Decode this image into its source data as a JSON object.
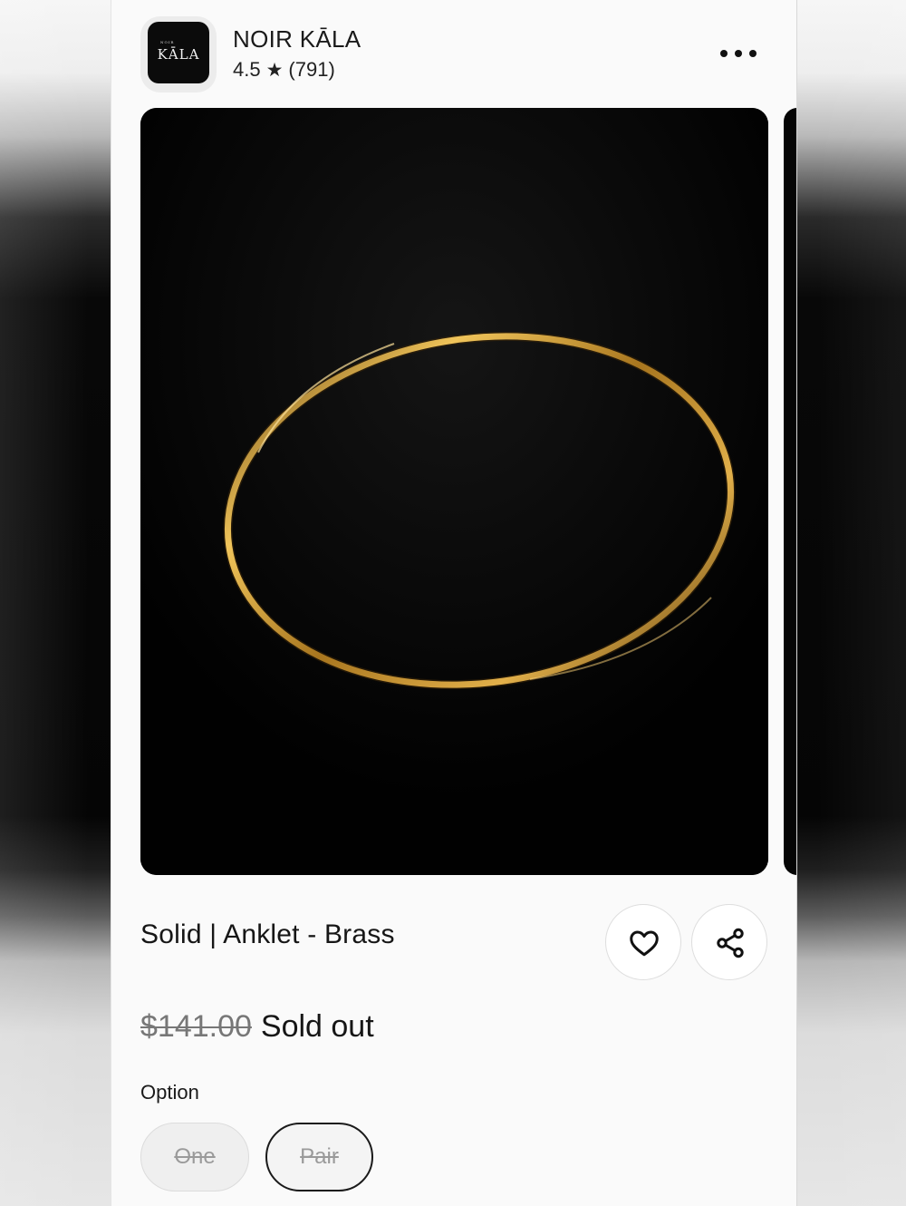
{
  "shop": {
    "logo_small": "NOIR",
    "logo_main": "KĀLA",
    "name": "NOIR KĀLA",
    "rating": "4.5",
    "star": "★",
    "review_count": "(791)"
  },
  "product": {
    "title": "Solid | Anklet - Brass",
    "original_price": "$141.00",
    "status": "Sold out"
  },
  "options": {
    "label": "Option",
    "items": [
      "One",
      "Pair"
    ],
    "selected": "Pair"
  },
  "icons": {
    "more": "more-horizontal-icon",
    "favorite": "heart-icon",
    "share": "share-icon",
    "rating": "star-icon"
  },
  "colors": {
    "image_background": "#020202",
    "brass": "#c9962f"
  }
}
